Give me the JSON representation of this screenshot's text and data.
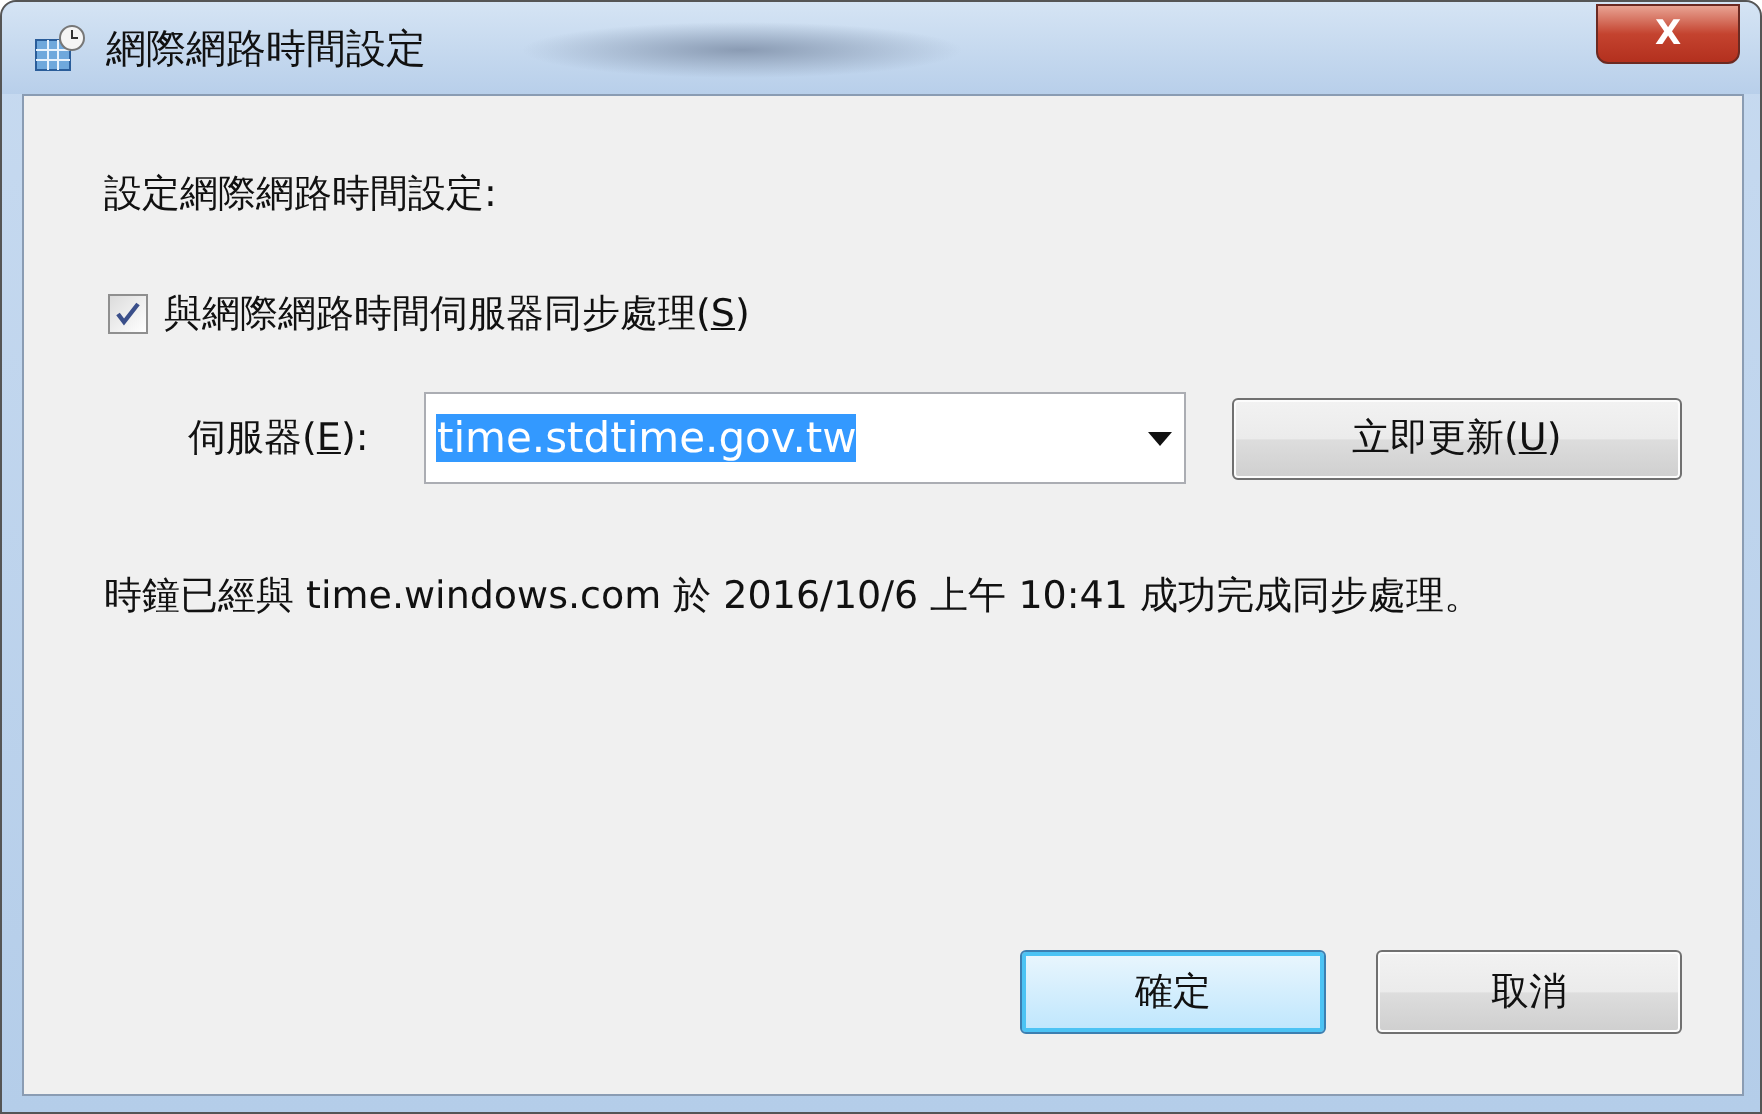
{
  "window": {
    "title": "網際網路時間設定",
    "close": "X"
  },
  "heading": "設定網際網路時間設定:",
  "sync_checkbox": {
    "before": "與網際網路時間伺服器同步處理(",
    "key": "S",
    "after": ")",
    "checked": true
  },
  "server": {
    "label_before": "伺服器(",
    "label_key": "E",
    "label_after": "):",
    "value": "time.stdtime.gov.tw",
    "value_selected": true
  },
  "update_button": {
    "before": "立即更新(",
    "key": "U",
    "after": ")"
  },
  "status": "時鐘已經與 time.windows.com 於 2016/10/6 上午 10:41 成功完成同步處理。",
  "buttons": [
    {
      "label": "確定",
      "default": true
    },
    {
      "label": "取消",
      "default": false
    }
  ]
}
